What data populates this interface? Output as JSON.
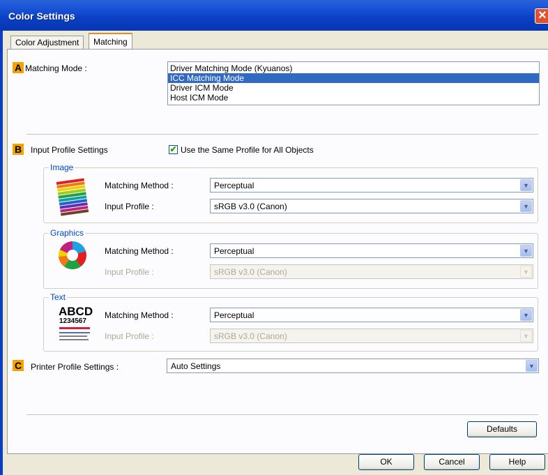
{
  "window": {
    "title": "Color Settings"
  },
  "tabs": [
    {
      "label": "Color Adjustment",
      "active": false
    },
    {
      "label": "Matching",
      "active": true
    }
  ],
  "matching_mode": {
    "marker": "A",
    "label": "Matching Mode :",
    "options": [
      {
        "label": "Driver Matching Mode (Kyuanos)",
        "selected": false
      },
      {
        "label": "ICC Matching Mode",
        "selected": true
      },
      {
        "label": "Driver ICM Mode",
        "selected": false
      },
      {
        "label": "Host ICM Mode",
        "selected": false
      }
    ]
  },
  "input_profile": {
    "marker": "B",
    "label": "Input Profile Settings",
    "same_profile_label": "Use the Same Profile for All Objects",
    "same_profile_checked": true,
    "groups": {
      "image": {
        "title": "Image",
        "icon": "colored-pencils-icon",
        "method_label": "Matching Method :",
        "method_value": "Perceptual",
        "profile_label": "Input Profile :",
        "profile_value": "sRGB v3.0 (Canon)",
        "profile_enabled": true
      },
      "graphics": {
        "title": "Graphics",
        "icon": "pie-chart-icon",
        "method_label": "Matching Method :",
        "method_value": "Perceptual",
        "profile_label": "Input Profile :",
        "profile_value": "sRGB v3.0 (Canon)",
        "profile_enabled": false
      },
      "text": {
        "title": "Text",
        "icon": "text-sample-icon",
        "icon_text_big": "ABCD",
        "icon_text_num": "1234567",
        "method_label": "Matching Method :",
        "method_value": "Perceptual",
        "profile_label": "Input Profile :",
        "profile_value": "sRGB v3.0 (Canon)",
        "profile_enabled": false
      }
    }
  },
  "printer_profile": {
    "marker": "C",
    "label": "Printer Profile Settings :",
    "value": "Auto Settings"
  },
  "buttons": {
    "defaults": "Defaults",
    "ok": "OK",
    "cancel": "Cancel",
    "help": "Help"
  },
  "colors": {
    "title_bar": "#0a3fc4",
    "marker": "#f5a300",
    "selection": "#316ac5",
    "group_label": "#0046d5"
  }
}
